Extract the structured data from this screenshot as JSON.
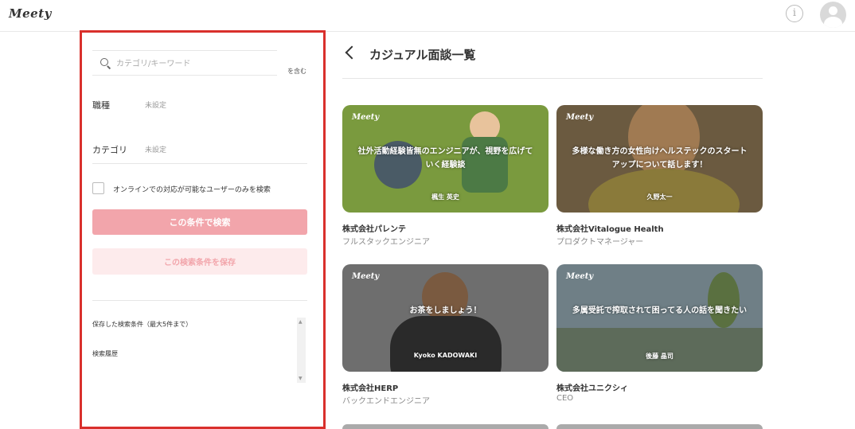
{
  "header": {
    "logo": "Meety",
    "info_label": "i"
  },
  "sidebar": {
    "search_placeholder": "カテゴリ/キーワード",
    "include_text": "を含む",
    "filters": [
      {
        "label": "職種",
        "value": "未設定"
      },
      {
        "label": "カテゴリ",
        "value": "未設定"
      }
    ],
    "online_only_label": "オンラインでの対応が可能なユーザーのみを検索",
    "search_button": "この条件で検索",
    "save_button": "この検索条件を保存",
    "saved_conditions_title": "保存した検索条件（最大5件まで）",
    "history_title": "検索履歴"
  },
  "main": {
    "title": "カジュアル面談一覧",
    "cards": [
      {
        "logo": "Meety",
        "thumb_title": "社外活動経験皆無のエンジニアが、視野を広げていく経験談",
        "host": "楓生 英史",
        "company": "株式会社パレンテ",
        "role": "フルスタックエンジニア",
        "bg": "#7a9a3e"
      },
      {
        "logo": "Meety",
        "thumb_title": "多様な働き方の女性向けヘルステックのスタートアップについて話します！",
        "host": "久野太一",
        "company": "株式会社Vitalogue Health",
        "role": "プロダクトマネージャー",
        "bg": "#6b5a40"
      },
      {
        "logo": "Meety",
        "thumb_title": "お茶をしましょう！",
        "host": "Kyoko KADOWAKI",
        "company": "株式会社HERP",
        "role": "バックエンドエンジニア",
        "bg": "#6e6e6e"
      },
      {
        "logo": "Meety",
        "thumb_title": "多属受託で搾取されて困ってる人の話を聞きたい",
        "host": "後藤 晶司",
        "company": "株式会社ユニクシィ",
        "role": "CEO",
        "bg": "#6f7f86"
      }
    ]
  }
}
